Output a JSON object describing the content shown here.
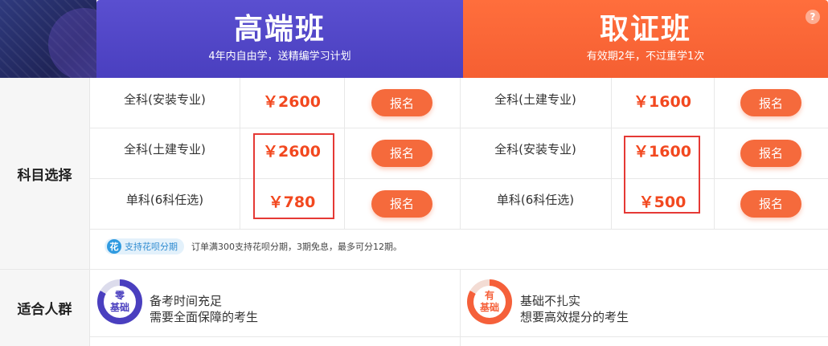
{
  "plans": [
    {
      "title": "高端班",
      "subtitle": "4年内自由学，送精编学习计划",
      "courses": [
        {
          "name": "全科(安装专业)",
          "price": "￥2600",
          "button": "报名"
        },
        {
          "name": "全科(土建专业)",
          "price": "￥2600",
          "button": "报名"
        },
        {
          "name": "单科(6科任选)",
          "price": "￥780",
          "button": "报名"
        }
      ],
      "audience": {
        "ring_top": "零",
        "ring_bottom": "基础",
        "line1": "备考时间充足",
        "line2": "需要全面保障的考生"
      }
    },
    {
      "title": "取证班",
      "subtitle": "有效期2年，不过重学1次",
      "courses": [
        {
          "name": "全科(土建专业)",
          "price": "￥1600",
          "button": "报名"
        },
        {
          "name": "全科(安装专业)",
          "price": "￥1600",
          "button": "报名"
        },
        {
          "name": "单科(6科任选)",
          "price": "￥500",
          "button": "报名"
        }
      ],
      "audience": {
        "ring_top": "有",
        "ring_bottom": "基础",
        "line1": "基础不扎实",
        "line2": "想要高效提分的考生"
      }
    }
  ],
  "help_icon": "?",
  "row_labels": {
    "subjects": "科目选择",
    "audience": "适合人群"
  },
  "installment": {
    "icon": "花",
    "badge": "支持花呗分期",
    "note": "订单满300支持花呗分期，3期免息，最多可分12期。"
  },
  "colors": {
    "plan_a": "#4a3fbf",
    "plan_b": "#f5603a",
    "price": "#f2481f",
    "button": "#f56a3c",
    "highlight_box": "#e53935"
  }
}
